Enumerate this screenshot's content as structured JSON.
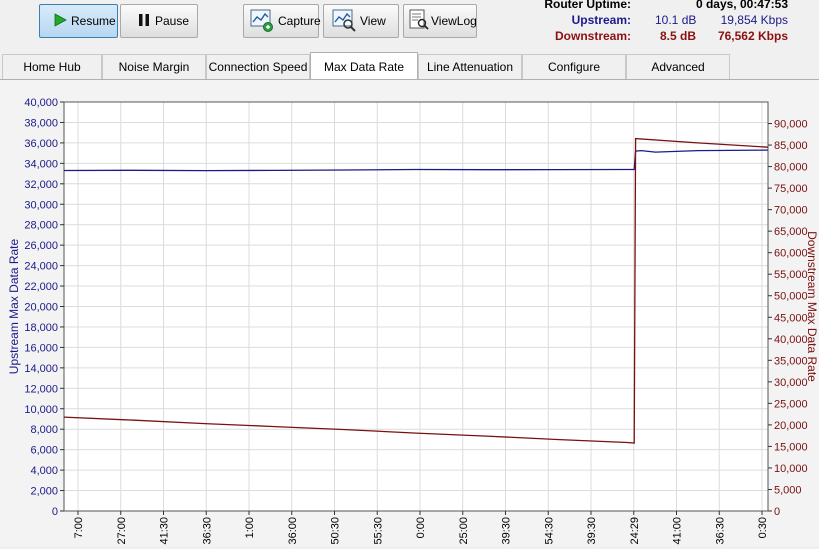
{
  "toolbar": {
    "resume_label": "Resume",
    "pause_label": "Pause",
    "capture_label": "Capture",
    "view_label": "View",
    "viewlog_label": "ViewLog"
  },
  "status": {
    "uptime_label": "Router Uptime:",
    "uptime_value": "0 days, 00:47:53",
    "upstream_label": "Upstream:",
    "upstream_db": "10.1 dB",
    "upstream_kbps": "19,854 Kbps",
    "downstream_label": "Downstream:",
    "downstream_db": "8.5 dB",
    "downstream_kbps": "76,562 Kbps"
  },
  "tabs": [
    {
      "label": "Home Hub"
    },
    {
      "label": "Noise Margin"
    },
    {
      "label": "Connection Speed"
    },
    {
      "label": "Max Data Rate"
    },
    {
      "label": "Line Attenuation"
    },
    {
      "label": "Configure"
    },
    {
      "label": "Advanced"
    }
  ],
  "colors": {
    "upstream": "#1a1a8a",
    "downstream": "#7a1010",
    "grid": "#dcdcdc",
    "active_button": "#b7d7f1"
  },
  "chart_data": {
    "type": "line",
    "ylabel": "Upstream Max Data Rate",
    "y2label": "Downstream Max Data Rate",
    "ylim": [
      0,
      40000
    ],
    "y2lim": [
      0,
      95000
    ],
    "yticks": [
      "0",
      "2,000",
      "4,000",
      "6,000",
      "8,000",
      "10,000",
      "12,000",
      "14,000",
      "16,000",
      "18,000",
      "20,000",
      "22,000",
      "24,000",
      "26,000",
      "28,000",
      "30,000",
      "32,000",
      "34,000",
      "36,000",
      "38,000",
      "40,000"
    ],
    "y2ticks": [
      "0",
      "5,000",
      "10,000",
      "15,000",
      "20,000",
      "25,000",
      "30,000",
      "35,000",
      "40,000",
      "45,000",
      "50,000",
      "55,000",
      "60,000",
      "65,000",
      "70,000",
      "75,000",
      "80,000",
      "85,000",
      "90,000"
    ],
    "xticks": [
      "7:00",
      "27:00",
      "41:30",
      "36:30",
      "1:00",
      "36:00",
      "50:30",
      "55:30",
      "0:00",
      "25:00",
      "39:30",
      "54:30",
      "39:30",
      "24:29",
      "41:00",
      "36:30",
      "0:30"
    ],
    "x_span": 100,
    "series": [
      {
        "name": "Upstream Max Data Rate",
        "axis": "left",
        "color": "#1a1a8a",
        "x": [
          0,
          10,
          20,
          30,
          40,
          50,
          60,
          70,
          80,
          81,
          81.2,
          82,
          84,
          90,
          100
        ],
        "y": [
          33300,
          33320,
          33290,
          33310,
          33350,
          33400,
          33380,
          33390,
          33400,
          33400,
          35200,
          35250,
          35100,
          35250,
          35300
        ]
      },
      {
        "name": "Downstream Max Data Rate",
        "axis": "right",
        "color": "#7a1010",
        "x": [
          0,
          10,
          20,
          30,
          40,
          50,
          60,
          70,
          80,
          81,
          81.2,
          90,
          100
        ],
        "y": [
          21800,
          21100,
          20300,
          19600,
          18900,
          18100,
          17400,
          16600,
          15900,
          15800,
          86500,
          85500,
          84500
        ]
      }
    ]
  }
}
